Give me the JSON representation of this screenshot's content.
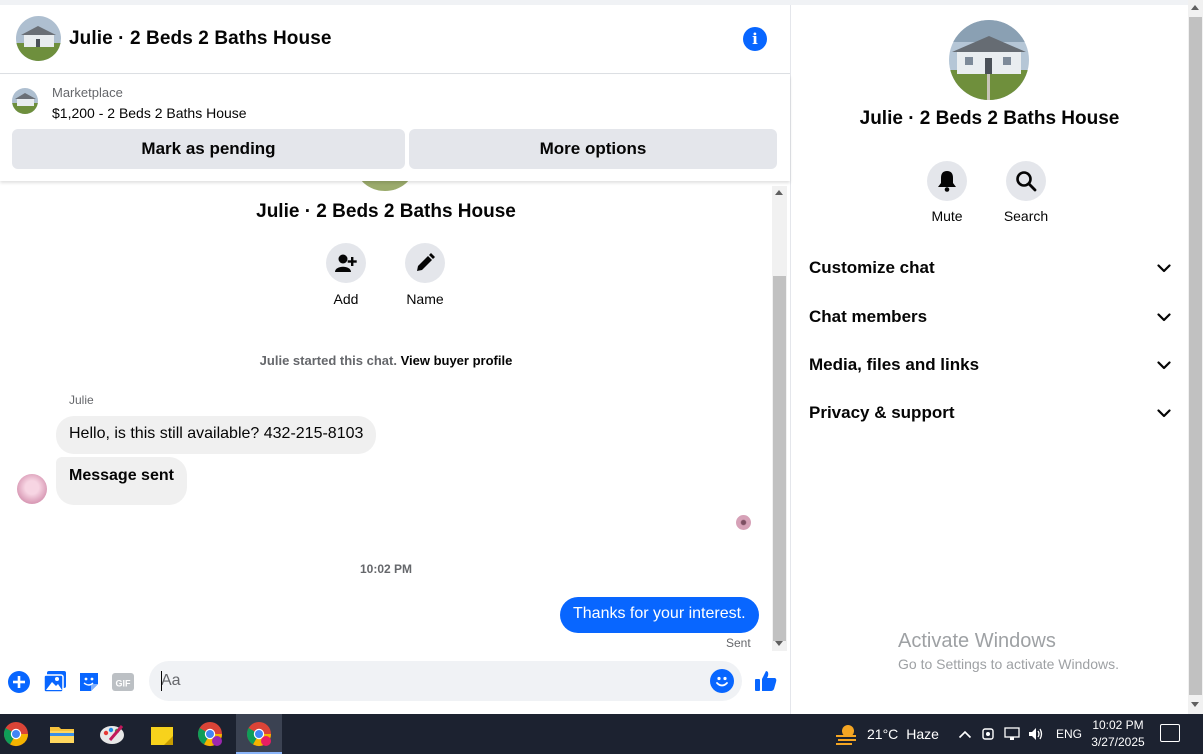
{
  "header": {
    "title": "Julie · 2 Beds 2 Baths House"
  },
  "marketplace": {
    "label": "Marketplace",
    "listing": "$1,200 - 2 Beds 2 Baths House",
    "mark_pending_label": "Mark as pending",
    "more_options_label": "More options"
  },
  "conversation": {
    "title": "Julie · 2 Beds 2 Baths House",
    "actions": [
      {
        "label": "Add",
        "icon": "add-person-icon"
      },
      {
        "label": "Name",
        "icon": "pencil-icon"
      }
    ],
    "started_text": "Julie started this chat.",
    "view_profile_label": "View buyer profile",
    "sender_name": "Julie",
    "messages_in": [
      "Hello, is this still available? 432-215-8103",
      "Message sent"
    ],
    "timestamp": "10:02 PM",
    "message_out": "Thanks for your interest.",
    "sent_status": "Sent"
  },
  "composer": {
    "placeholder": "Aa",
    "icons": [
      "plus-icon",
      "photo-icon",
      "sticker-icon",
      "gif-icon",
      "emoji-icon",
      "thumbs-up-icon"
    ],
    "gif_label": "GIF"
  },
  "side_panel": {
    "title": "Julie · 2 Beds 2 Baths House",
    "actions": [
      {
        "label": "Mute",
        "icon": "bell-icon"
      },
      {
        "label": "Search",
        "icon": "search-icon"
      }
    ],
    "sections": [
      "Customize chat",
      "Chat members",
      "Media, files and links",
      "Privacy & support"
    ]
  },
  "watermark": {
    "line1": "Activate Windows",
    "line2": "Go to Settings to activate Windows."
  },
  "taskbar": {
    "weather_temp": "21°C",
    "weather_text": "Haze",
    "language": "ENG",
    "time": "10:02 PM",
    "date": "3/27/2025"
  },
  "colors": {
    "accent": "#0866ff",
    "bubble_gray": "#f0f0f0",
    "button_gray": "#e4e6eb",
    "taskbar": "#1c2230"
  }
}
